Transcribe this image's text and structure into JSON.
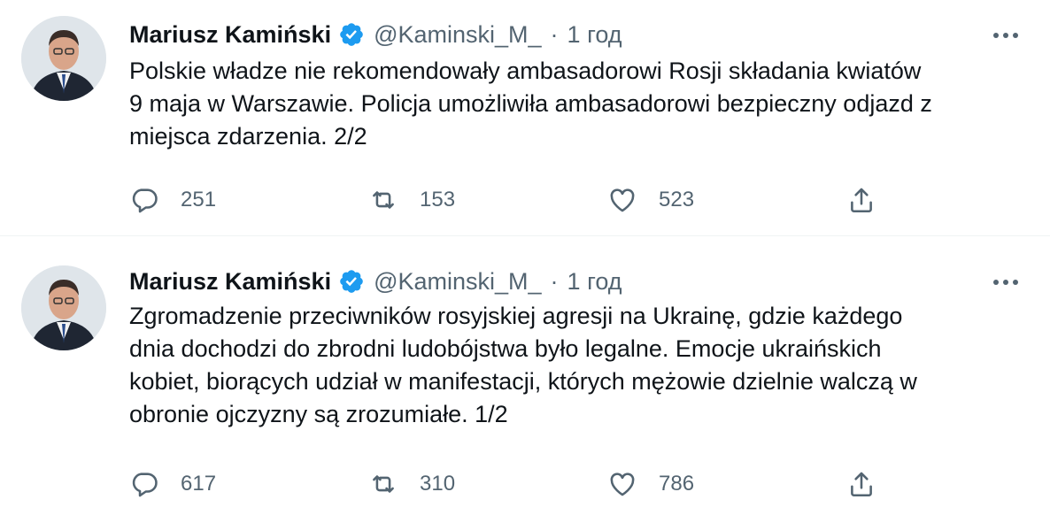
{
  "tweets": [
    {
      "author_name": "Mariusz Kamiński",
      "handle": "@Kaminski_M_",
      "separator": "·",
      "time": "1 год",
      "text": "Polskie władze nie rekomendowały ambasadorowi Rosji składania kwiatów\n9 maja w Warszawie. Policja umożliwiła ambasadorowi bezpieczny odjazd z\nmiejsca zdarzenia. 2/2",
      "replies": "251",
      "retweets": "153",
      "likes": "523"
    },
    {
      "author_name": "Mariusz Kamiński",
      "handle": "@Kaminski_M_",
      "separator": "·",
      "time": "1 год",
      "text": "Zgromadzenie przeciwników rosyjskiej agresji na Ukrainę, gdzie każdego\ndnia dochodzi do zbrodni ludobójstwa było legalne. Emocje ukraińskich\nkobiet, biorących udział w manifestacji, których mężowie dzielnie walczą w\nobronie ojczyzny są zrozumiałe. 1/2",
      "replies": "617",
      "retweets": "310",
      "likes": "786"
    }
  ],
  "colors": {
    "verified_badge": "#1d9bf0",
    "secondary_text": "#536471",
    "primary_text": "#0f1419",
    "divider": "#eff3f4"
  },
  "icons": [
    "verified-badge-icon",
    "more-icon",
    "reply-icon",
    "retweet-icon",
    "like-icon",
    "share-icon"
  ]
}
